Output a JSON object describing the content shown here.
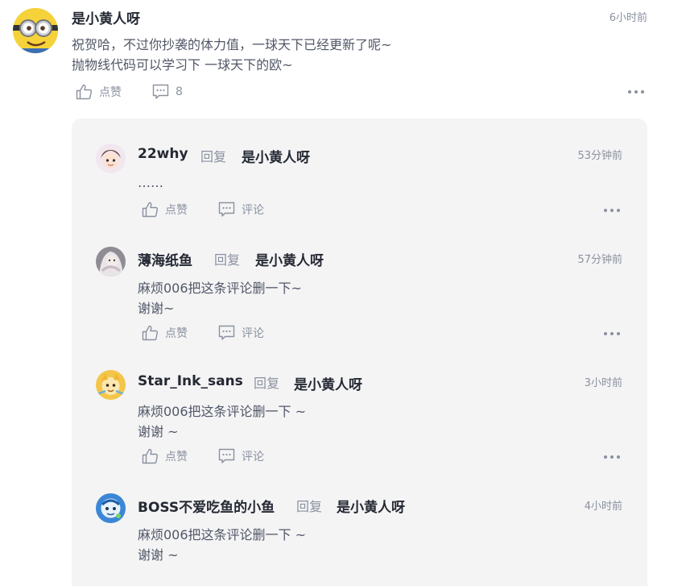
{
  "main_comment": {
    "author": "是小黄人呀",
    "time": "6小时前",
    "line1": "祝贺哈，不过你抄袭的体力值，一球天下已经更新了呢~",
    "line2": "抛物线代码可以学习下 一球天下的欧~",
    "like_label": "点赞",
    "comment_count": "8"
  },
  "replies": [
    {
      "author": "22why",
      "reply_word": "回复",
      "target": "是小黄人呀",
      "time": "53分钟前",
      "line1": "……",
      "line2": "",
      "like_label": "点赞",
      "comment_label": "评论"
    },
    {
      "author": "薄海纸鱼",
      "reply_word": "回复",
      "target": "是小黄人呀",
      "time": "57分钟前",
      "line1": "麻烦006把这条评论删一下~",
      "line2": "谢谢~",
      "like_label": "点赞",
      "comment_label": "评论"
    },
    {
      "author": "Star_Ink_sans",
      "reply_word": "回复",
      "target": "是小黄人呀",
      "time": "3小时前",
      "line1": "麻烦006把这条评论删一下 ~",
      "line2": "谢谢 ~",
      "like_label": "点赞",
      "comment_label": "评论"
    },
    {
      "author": "BOSS不爱吃鱼的小鱼",
      "reply_word": "回复",
      "target": "是小黄人呀",
      "time": "4小时前",
      "line1": "麻烦006把这条评论删一下 ~",
      "line2": "谢谢 ~"
    }
  ]
}
